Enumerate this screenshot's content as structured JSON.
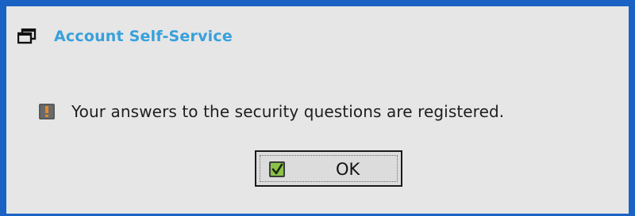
{
  "window": {
    "title": "Account Self-Service",
    "title_icon": "window-restore-icon"
  },
  "message": {
    "icon": "warning-icon",
    "text": "Your answers to the security questions are registered."
  },
  "ok_button": {
    "label": "OK",
    "icon": "checkmark-icon"
  },
  "colors": {
    "frame_border": "#1a63c4",
    "title_text": "#37a0dc",
    "background": "#e6e6e6",
    "warning_icon": "#c77a2a",
    "check_icon": "#8bc34a"
  }
}
